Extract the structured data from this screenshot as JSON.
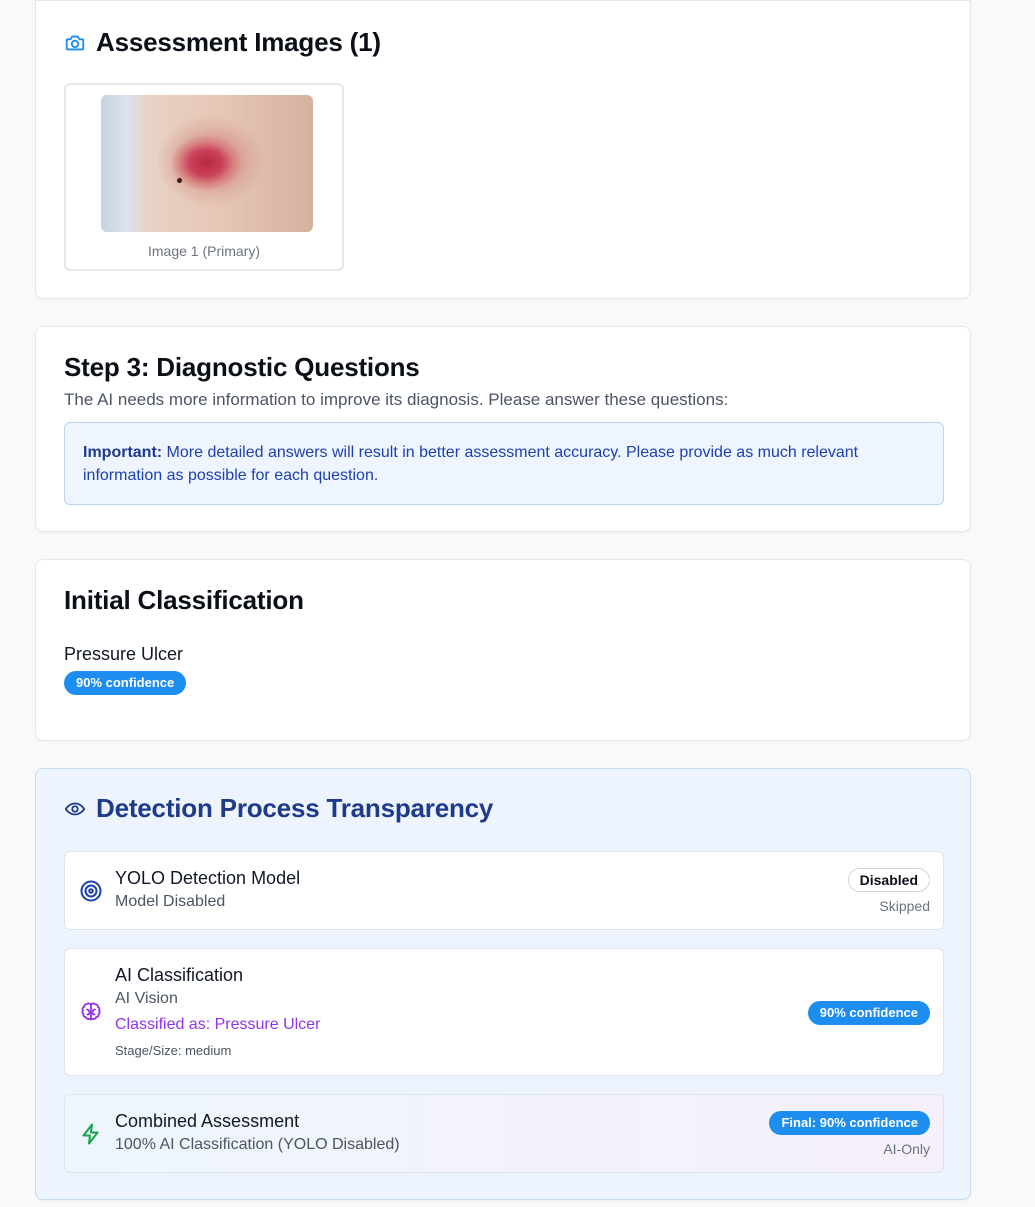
{
  "images_card": {
    "title": "Assessment Images (1)",
    "icon": "camera-icon",
    "images": [
      {
        "caption": "Image 1 (Primary)"
      }
    ]
  },
  "step3": {
    "title": "Step 3: Diagnostic Questions",
    "description": "The AI needs more information to improve its diagnosis. Please answer these questions:",
    "notice_label": "Important:",
    "notice_text": " More detailed answers will result in better assessment accuracy. Please provide as much relevant information as possible for each question."
  },
  "initial_classification": {
    "title": "Initial Classification",
    "label": "Pressure Ulcer",
    "confidence": "90% confidence"
  },
  "detection": {
    "title": "Detection Process Transparency",
    "icon": "eye-icon",
    "rows": [
      {
        "icon": "target-icon",
        "title": "YOLO Detection Model",
        "subtitle": "Model Disabled",
        "badge": "Disabled",
        "note": "Skipped"
      },
      {
        "icon": "brain-icon",
        "title": "AI Classification",
        "subtitle": "AI Vision",
        "classified": "Classified as: Pressure Ulcer",
        "stage": "Stage/Size: medium",
        "badge": "90% confidence"
      },
      {
        "icon": "lightning-icon",
        "title": "Combined Assessment",
        "subtitle": "100% AI Classification (YOLO Disabled)",
        "badge": "Final: 90% confidence",
        "note": "AI-Only"
      }
    ]
  },
  "colors": {
    "accent_blue": "#1d8ef0",
    "heading_navy": "#1e3a8a",
    "ai_purple": "#9333ea",
    "combined_green": "#16a34a"
  }
}
